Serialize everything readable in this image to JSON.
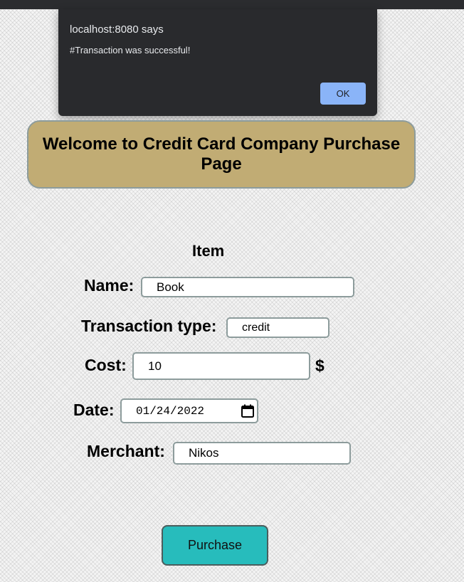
{
  "dialog": {
    "origin": "localhost:8080 says",
    "message": "#Transaction was successful!",
    "ok_label": "OK"
  },
  "header": {
    "title": "Welcome to Credit Card Company Purchase Page"
  },
  "form": {
    "heading": "Item",
    "name": {
      "label": "Name:",
      "value": "Book"
    },
    "transaction_type": {
      "label": "Transaction type:",
      "value": "credit"
    },
    "cost": {
      "label": "Cost:",
      "value": "10",
      "currency": "$"
    },
    "date": {
      "label": "Date:",
      "value": "01/24/2022",
      "icon": "calendar-icon"
    },
    "merchant": {
      "label": "Merchant:",
      "value": "Nikos"
    },
    "submit_label": "Purchase"
  },
  "colors": {
    "header_bg": "#c1ac74",
    "button_bg": "#27bcbc",
    "dialog_bg": "#292a2d",
    "dialog_ok_bg": "#8ab4f8"
  }
}
